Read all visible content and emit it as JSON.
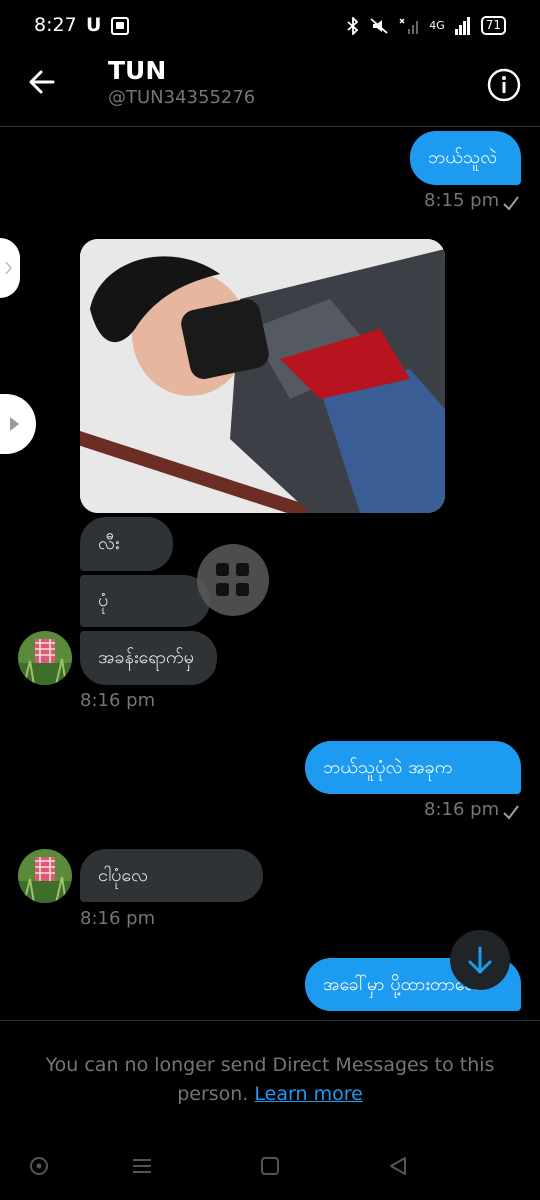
{
  "status_bar": {
    "time": "8:27",
    "u_indicator": "U",
    "network": "4G",
    "battery": "71"
  },
  "header": {
    "name": "TUN",
    "handle": "@TUN34355276"
  },
  "messages": {
    "sent_1": {
      "text": "ဘယ်သူလဲ",
      "time": "8:15 pm"
    },
    "recv_group_1": {
      "bubbles": [
        "လီး",
        "ပုံ",
        "အခန်းရောက်မှ"
      ],
      "time": "8:16 pm"
    },
    "sent_2": {
      "text": "ဘယ်သူပုံလဲ အခုက",
      "time": "8:16 pm"
    },
    "recv_2": {
      "text": "ငါပုံလေ",
      "time": "8:16 pm"
    },
    "sent_3": {
      "text": "အခေါ်မှာ ပို့ထားတာလေ"
    }
  },
  "footer": {
    "notice": "You can no longer send Direct Messages to this person.",
    "link": "Learn more"
  },
  "colors": {
    "accent": "#1d9bf0",
    "received_bubble": "#2f3336",
    "muted_text": "#71767b"
  },
  "icons": [
    "back-arrow-icon",
    "info-icon",
    "checkmark-icon",
    "grid-icon",
    "arrow-down-icon",
    "chevron-right-icon",
    "home-circle-icon",
    "menu-lines-icon",
    "square-icon",
    "triangle-back-icon"
  ]
}
